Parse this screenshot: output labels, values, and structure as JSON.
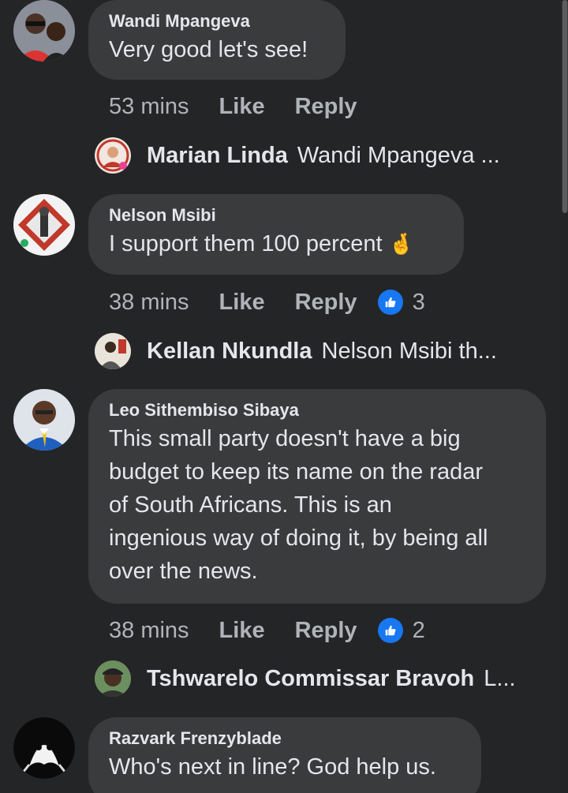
{
  "comments": [
    {
      "author": "Wandi Mpangeva",
      "text": "Very good let's see!",
      "time": "53 mins",
      "like": "Like",
      "reply": "Reply",
      "reply_preview": {
        "author": "Marian Linda",
        "snippet": "Wandi Mpangeva ..."
      }
    },
    {
      "author": "Nelson Msibi",
      "text": "I support them 100 percent",
      "emoji": "🤞",
      "time": "38 mins",
      "like": "Like",
      "reply": "Reply",
      "reactions": "3",
      "reply_preview": {
        "author": "Kellan Nkundla",
        "snippet": "Nelson Msibi th..."
      }
    },
    {
      "author": "Leo Sithembiso Sibaya",
      "text_lines": [
        "This small party doesn't have a big",
        "budget to keep its name on the radar",
        "of South Africans. This is an",
        "ingenious way of doing it, by being all",
        "over the news."
      ],
      "time": "38 mins",
      "like": "Like",
      "reply": "Reply",
      "reactions": "2",
      "reply_preview": {
        "author": "Tshwarelo Commissar Bravoh",
        "snippet": "L..."
      }
    },
    {
      "author": "Razvark Frenzyblade",
      "text": "Who's next in line? God help us."
    }
  ],
  "colors": {
    "background": "#242526",
    "bubble": "#3a3b3c",
    "primary_text": "#e4e6eb",
    "secondary_text": "#b0b3b8",
    "like_badge": "#1877f2"
  }
}
